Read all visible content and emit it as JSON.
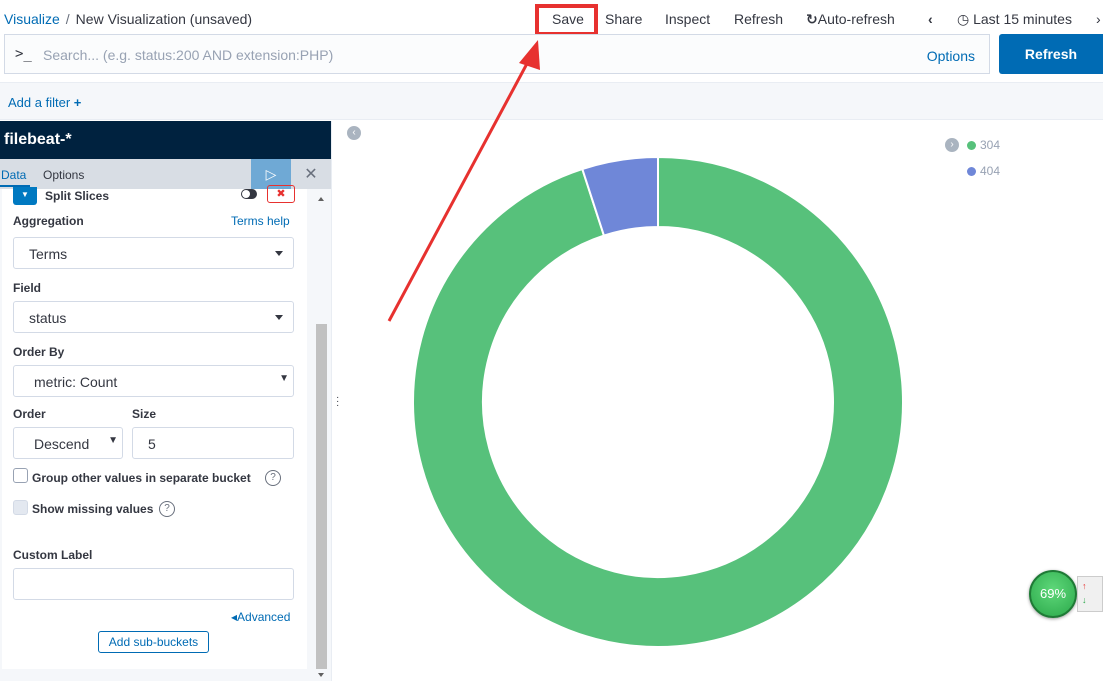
{
  "breadcrumb": {
    "parent": "Visualize",
    "separator": "/",
    "current": "New Visualization (unsaved)"
  },
  "top_menu": {
    "save": "Save",
    "share": "Share",
    "inspect": "Inspect",
    "refresh": "Refresh",
    "auto_refresh": "Auto-refresh",
    "time_range": "Last 15 minutes"
  },
  "search": {
    "prompt": ">_",
    "placeholder": "Search... (e.g. status:200 AND extension:PHP)",
    "options_label": "Options",
    "refresh_button": "Refresh"
  },
  "filter_bar": {
    "add_filter": "Add a filter"
  },
  "sidebar": {
    "index_pattern": "filebeat-*",
    "tabs": {
      "data": "Data",
      "options": "Options"
    },
    "bucket": {
      "title": "Split Slices",
      "aggregation_label": "Aggregation",
      "terms_help": "Terms help",
      "aggregation_value": "Terms",
      "field_label": "Field",
      "field_value": "status",
      "order_by_label": "Order By",
      "order_by_value": "metric: Count",
      "order_label": "Order",
      "order_value": "Descend",
      "size_label": "Size",
      "size_value": "5",
      "group_other_label": "Group other values in separate bucket",
      "show_missing_label": "Show missing values",
      "custom_label_label": "Custom Label",
      "custom_label_value": "",
      "advanced": "Advanced",
      "add_sub_buckets": "Add sub-buckets"
    }
  },
  "chart_data": {
    "type": "pie",
    "donut": true,
    "categories": [
      "304",
      "404"
    ],
    "values": [
      95,
      5
    ],
    "colors": [
      "#57c17b",
      "#6f87d8"
    ],
    "legend_position": "top-right"
  },
  "perf_widget": {
    "percent": "69%"
  },
  "colors": {
    "accent": "#006bb4",
    "highlight": "#e7312f",
    "header_dark": "#00223f"
  }
}
